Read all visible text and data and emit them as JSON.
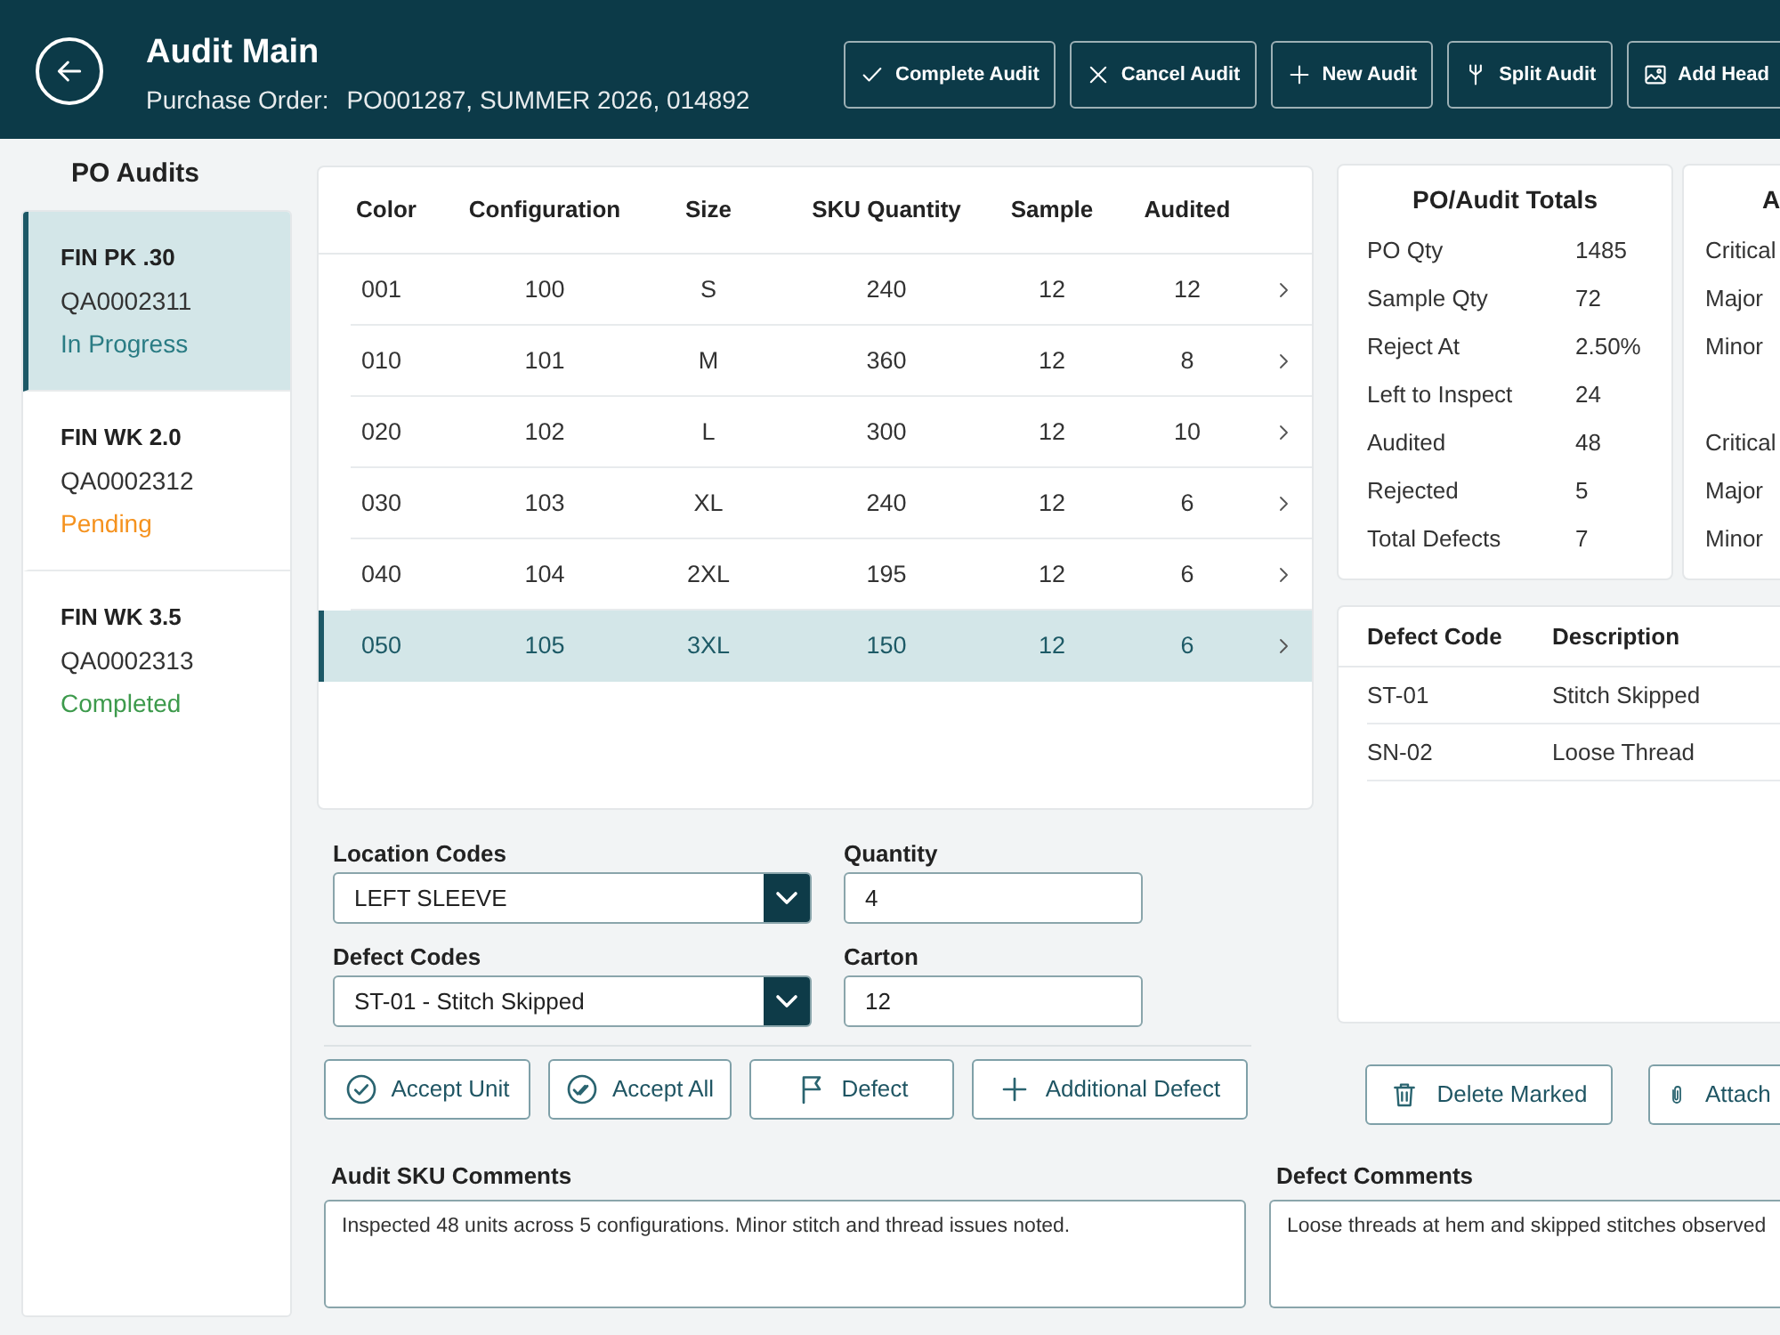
{
  "header": {
    "title": "Audit Main",
    "order_label": "Purchase Order:",
    "order_value": "PO001287, SUMMER 2026, 014892",
    "actions": [
      "Complete Audit",
      "Cancel Audit",
      "New Audit",
      "Split Audit",
      "Add Head"
    ]
  },
  "sidebar": {
    "title": "PO Audits",
    "items": [
      {
        "name": "FIN PK .30",
        "code": "QA0002311",
        "status": "In Progress",
        "color": "#2a7c84",
        "selected": true
      },
      {
        "name": "FIN WK 2.0",
        "code": "QA0002312",
        "status": "Pending",
        "color": "#f5921e",
        "selected": false
      },
      {
        "name": "FIN WK 3.5",
        "code": "QA0002313",
        "status": "Completed",
        "color": "#3d9a4c",
        "selected": false
      }
    ]
  },
  "sku_table": {
    "columns": [
      "Color",
      "Configuration",
      "Size",
      "SKU Quantity",
      "Sample",
      "Audited"
    ],
    "rows": [
      {
        "cells": [
          "001",
          "100",
          "S",
          "240",
          "12",
          "12"
        ],
        "selected": false
      },
      {
        "cells": [
          "010",
          "101",
          "M",
          "360",
          "12",
          "8"
        ],
        "selected": false
      },
      {
        "cells": [
          "020",
          "102",
          "L",
          "300",
          "12",
          "10"
        ],
        "selected": false
      },
      {
        "cells": [
          "030",
          "103",
          "XL",
          "240",
          "12",
          "6"
        ],
        "selected": false
      },
      {
        "cells": [
          "040",
          "104",
          "2XL",
          "195",
          "12",
          "6"
        ],
        "selected": false
      },
      {
        "cells": [
          "050",
          "105",
          "3XL",
          "150",
          "12",
          "6"
        ],
        "selected": true
      }
    ]
  },
  "form": {
    "fields": [
      {
        "kind": "select",
        "label": "Location Codes",
        "value": "LEFT SLEEVE"
      },
      {
        "kind": "text",
        "label": "Quantity",
        "value": "4"
      },
      {
        "kind": "select",
        "label": "Defect Codes",
        "value": "ST-01 - Stitch Skipped"
      },
      {
        "kind": "text",
        "label": "Carton",
        "value": "12"
      }
    ],
    "actions": [
      "Accept Unit",
      "Accept All",
      "Defect",
      "Additional Defect"
    ]
  },
  "totals": {
    "title": "PO/Audit Totals",
    "rows": [
      {
        "label": "PO Qty",
        "value": "1485"
      },
      {
        "label": "Sample Qty",
        "value": "72"
      },
      {
        "label": "Reject At",
        "value": "2.50%"
      },
      {
        "label": "Left to Inspect",
        "value": "24"
      },
      {
        "label": "Audited",
        "value": "48"
      },
      {
        "label": "Rejected",
        "value": "5"
      },
      {
        "label": "Total Defects",
        "value": "7"
      }
    ]
  },
  "card_2": {
    "title": "A",
    "groups": [
      [
        "Critical",
        "Major",
        "Minor"
      ],
      [
        "Critical",
        "Major",
        "Minor"
      ]
    ]
  },
  "defects": {
    "columns": [
      "Defect Code",
      "Description"
    ],
    "rows": [
      [
        "ST-01",
        "Stitch Skipped"
      ],
      [
        "SN-02",
        "Loose Thread"
      ]
    ],
    "actions": [
      "Delete Marked",
      "Attach"
    ]
  },
  "comments": [
    {
      "label": "Audit SKU Comments",
      "value": "Inspected 48 units across 5 configurations. Minor stitch and thread issues noted."
    },
    {
      "label": "Defect Comments",
      "value": "Loose threads at hem and skipped stitches observed"
    }
  ]
}
